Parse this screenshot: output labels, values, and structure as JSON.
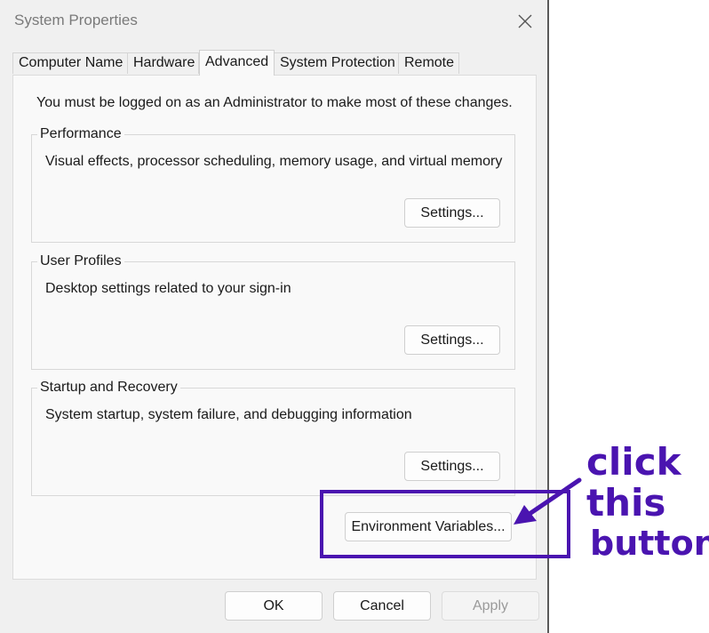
{
  "window": {
    "title": "System Properties"
  },
  "tabs": [
    {
      "label": "Computer Name"
    },
    {
      "label": "Hardware"
    },
    {
      "label": "Advanced"
    },
    {
      "label": "System Protection"
    },
    {
      "label": "Remote"
    }
  ],
  "active_tab": "Advanced",
  "panel": {
    "admin_note": "You must be logged on as an Administrator to make most of these changes.",
    "groups": [
      {
        "title": "Performance",
        "description": "Visual effects, processor scheduling, memory usage, and virtual memory",
        "button_label": "Settings..."
      },
      {
        "title": "User Profiles",
        "description": "Desktop settings related to your sign-in",
        "button_label": "Settings..."
      },
      {
        "title": "Startup and Recovery",
        "description": "System startup, system failure, and debugging information",
        "button_label": "Settings..."
      }
    ],
    "env_button_label": "Environment Variables..."
  },
  "footer": {
    "ok_label": "OK",
    "cancel_label": "Cancel",
    "apply_label": "Apply"
  },
  "annotation": {
    "lines": [
      "click",
      "this",
      "button"
    ],
    "color": "#4a14b0"
  }
}
